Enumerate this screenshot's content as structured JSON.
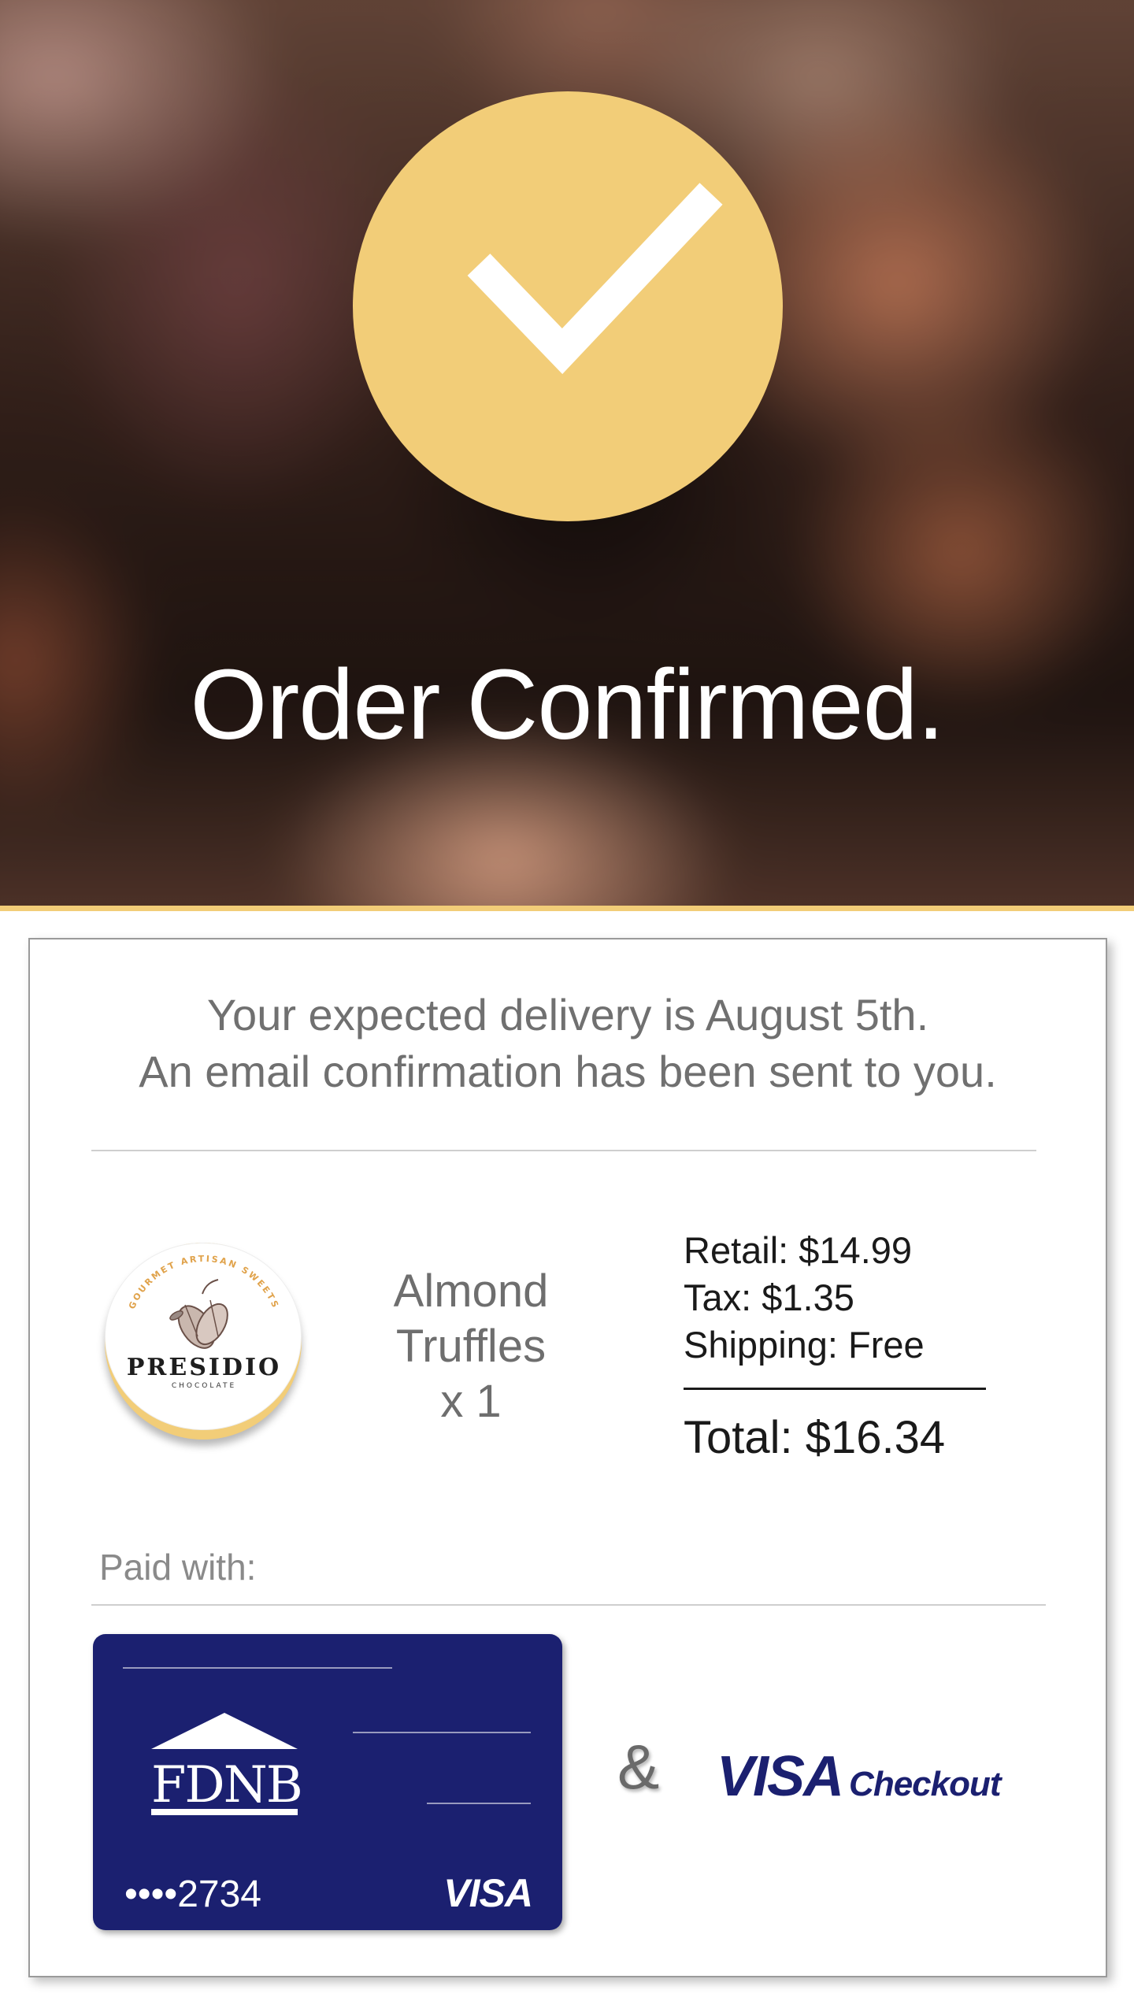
{
  "hero": {
    "title": "Order Confirmed.",
    "icon": "checkmark-icon",
    "accent_color": "#f2cd78"
  },
  "receipt": {
    "delivery_line1": "Your expected delivery is August 5th.",
    "delivery_line2": "An email confirmation has been sent to you.",
    "merchant": {
      "tagline": "GOURMET ARTISAN SWEETS",
      "name": "PRESIDIO",
      "subname": "CHOCOLATE"
    },
    "product": {
      "name_line1": "Almond",
      "name_line2": "Truffles",
      "quantity": "x 1"
    },
    "pricing": {
      "retail": "Retail: $14.99",
      "tax": "Tax: $1.35",
      "shipping": "Shipping: Free",
      "total": "Total: $16.34"
    },
    "payment": {
      "label": "Paid with:",
      "bank": "FDNB",
      "card_number": "••••2734",
      "card_network": "VISA",
      "card_color": "#1b2070",
      "joiner": "&",
      "wallet_brand": "VISA",
      "wallet_product": "Checkout"
    }
  }
}
